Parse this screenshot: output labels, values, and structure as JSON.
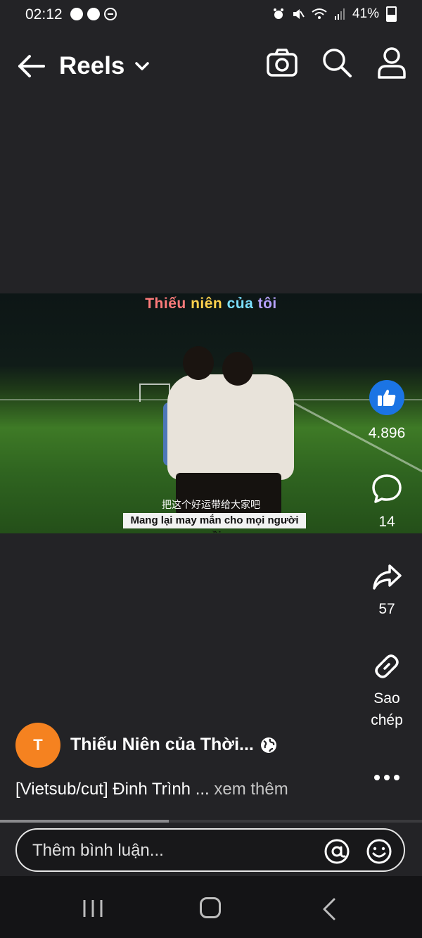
{
  "status_bar": {
    "time": "02:12",
    "battery": "41%"
  },
  "header": {
    "title": "Reels"
  },
  "video": {
    "overlay_title": [
      "Thiếu ",
      "niên ",
      "của ",
      "tôi"
    ],
    "subtitle_cn": "把这个好运带给大家吧",
    "subtitle_vi": "Mang lại may mắn cho mọi người rồi"
  },
  "actions": {
    "likes": "4.896",
    "comments": "14",
    "shares": "57",
    "copy_label_1": "Sao",
    "copy_label_2": "chép"
  },
  "author": {
    "avatar_letter": "T",
    "name": "Thiếu Niên của Thời..."
  },
  "caption": {
    "text": "[Vietsub/cut] Đinh Trình ... ",
    "more": "xem thêm"
  },
  "playback": {
    "progress_fraction": 0.4
  },
  "comment_box": {
    "placeholder": "Thêm bình luận..."
  },
  "colors": {
    "background": "#232326",
    "like_blue": "#1b74e4",
    "avatar_orange": "#f58220"
  },
  "icons": [
    "arrow-left-icon",
    "chevron-down-icon",
    "camera-icon",
    "search-icon",
    "profile-icon",
    "like-icon",
    "comment-icon",
    "share-icon",
    "link-icon",
    "globe-icon",
    "more-icon",
    "at-icon",
    "smile-icon"
  ]
}
